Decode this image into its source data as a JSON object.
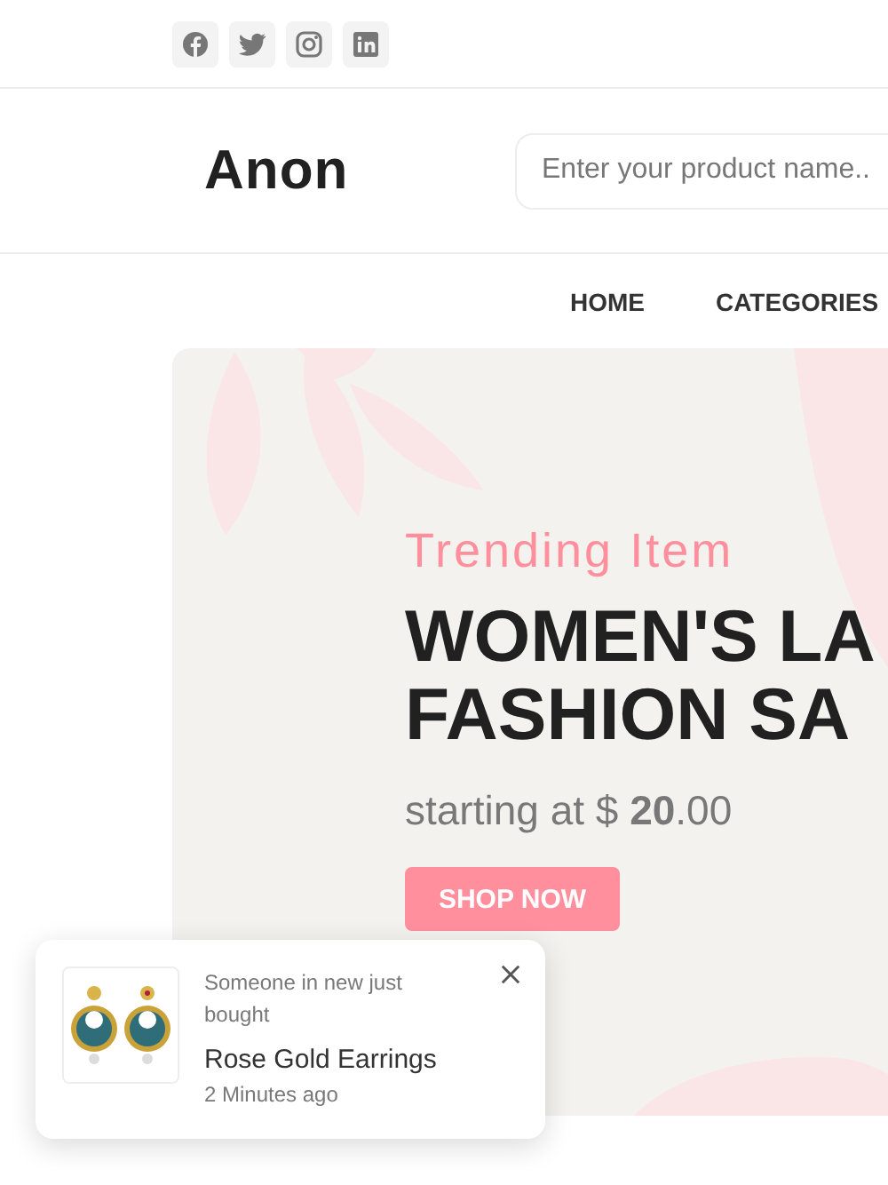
{
  "logo": "Anon",
  "search": {
    "placeholder": "Enter your product name.."
  },
  "nav": [
    {
      "label": "HOME"
    },
    {
      "label": "CATEGORIES"
    }
  ],
  "banner": {
    "subtitle": "Trending Item",
    "title_lines": [
      "WOMEN'S LA",
      "FASHION SA"
    ],
    "price": "starting at $ **20**.00",
    "button": "SHOP NOW"
  },
  "toast": {
    "message": "Someone in new just bought",
    "product": "Rose Gold Earrings",
    "time": "2 Minutes ago"
  }
}
